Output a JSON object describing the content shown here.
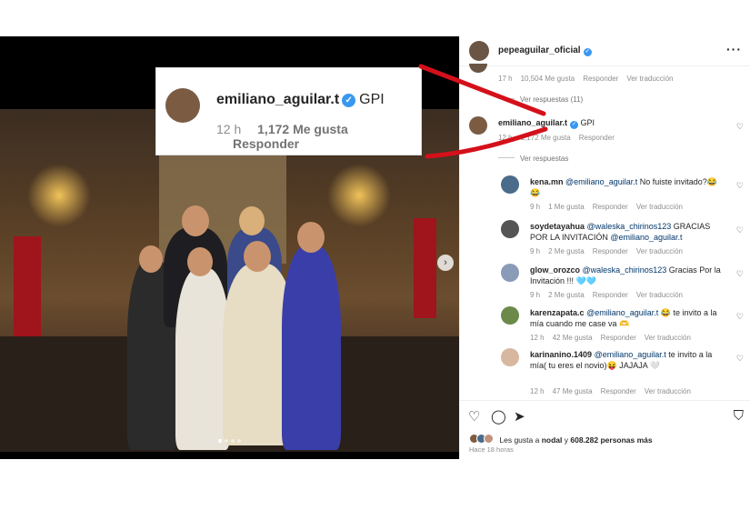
{
  "callout": {
    "username": "emiliano_aguilar.t",
    "text": "GPI",
    "time": "12 h",
    "likes": "1,172 Me gusta",
    "reply": "Responder"
  },
  "post": {
    "author": "pepeaguilar_oficial",
    "more_icon": "more-horizontal-icon"
  },
  "comments": [
    {
      "meta_time": "17 h",
      "likes": "10,504 Me gusta",
      "reply": "Responder",
      "translate": "Ver traducción"
    },
    {
      "view_replies": "Ver respuestas (11)"
    },
    {
      "username": "emiliano_aguilar.t",
      "text": "GPI",
      "time": "12 h",
      "likes": "1,172 Me gusta",
      "reply": "Responder"
    },
    {
      "view_replies": "Ver respuestas"
    }
  ],
  "replies": [
    {
      "username": "kena.mn",
      "mention": "@emiliano_aguilar.t",
      "text": "No fuiste invitado?😂😂",
      "time": "9 h",
      "likes": "1 Me gusta",
      "reply": "Responder",
      "translate": "Ver traducción"
    },
    {
      "username": "soydetayahua",
      "mention": "@waleska_chirinos123",
      "text": "GRACIAS POR LA INVITACIÓN",
      "mention2": "@emiliano_aguilar.t",
      "time": "9 h",
      "likes": "2 Me gusta",
      "reply": "Responder",
      "translate": "Ver traducción"
    },
    {
      "username": "glow_orozco",
      "mention": "@waleska_chirinos123",
      "text": "Gracias Por la Invitación !!! 🩵🩵",
      "time": "9 h",
      "likes": "2 Me gusta",
      "reply": "Responder",
      "translate": "Ver traducción"
    },
    {
      "username": "karenzapata.c",
      "mention": "@emiliano_aguilar.t",
      "text": "😂 te invito a la mía cuando me case va 🫶",
      "time": "12 h",
      "likes": "42 Me gusta",
      "reply": "Responder",
      "translate": "Ver traducción"
    },
    {
      "username": "karinanino.1409",
      "mention": "@emiliano_aguilar.t",
      "text": "te invito a la mía( tu eres el novio)😝 JAJAJA 🤍",
      "time": "12 h",
      "likes": "47 Me gusta",
      "reply": "Responder",
      "translate": "Ver traducción"
    }
  ],
  "footer": {
    "likes_prefix": "Les gusta a",
    "likes_user": "nodal",
    "likes_mid": "y",
    "likes_count": "608.282 personas más",
    "time": "Hace 18 horas"
  },
  "colors": {
    "accent_red": "#d4101b",
    "verified_blue": "#3897f0"
  }
}
